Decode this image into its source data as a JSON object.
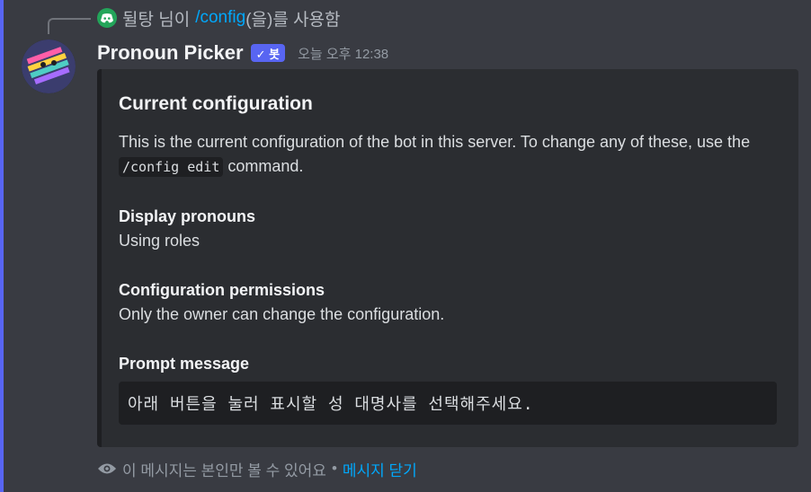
{
  "reply": {
    "user": "뒬탕 님이",
    "command": "/config",
    "suffix": "(을)를 사용함"
  },
  "message": {
    "author": "Pronoun Picker",
    "badge": "✓ 봇",
    "timestamp_prefix": "오늘 오후",
    "timestamp_time": "12:38"
  },
  "embed": {
    "title": "Current configuration",
    "desc_before": "This is the current configuration of the bot in this server. To change any of these, use the ",
    "desc_code": "/config edit",
    "desc_after": " command.",
    "fields": [
      {
        "name": "Display pronouns",
        "value": "Using roles"
      },
      {
        "name": "Configuration permissions",
        "value": "Only the owner can change the configuration."
      },
      {
        "name": "Prompt message",
        "value": "아래 버튼을 눌러 표시할 성 대명사를 선택해주세요."
      }
    ]
  },
  "ephemeral": {
    "notice": "이 메시지는 본인만 볼 수 있어요",
    "separator": "•",
    "dismiss": "메시지 닫기"
  },
  "colors": {
    "accent": "#5865f2",
    "link": "#00a8fc",
    "background": "#393b42"
  }
}
